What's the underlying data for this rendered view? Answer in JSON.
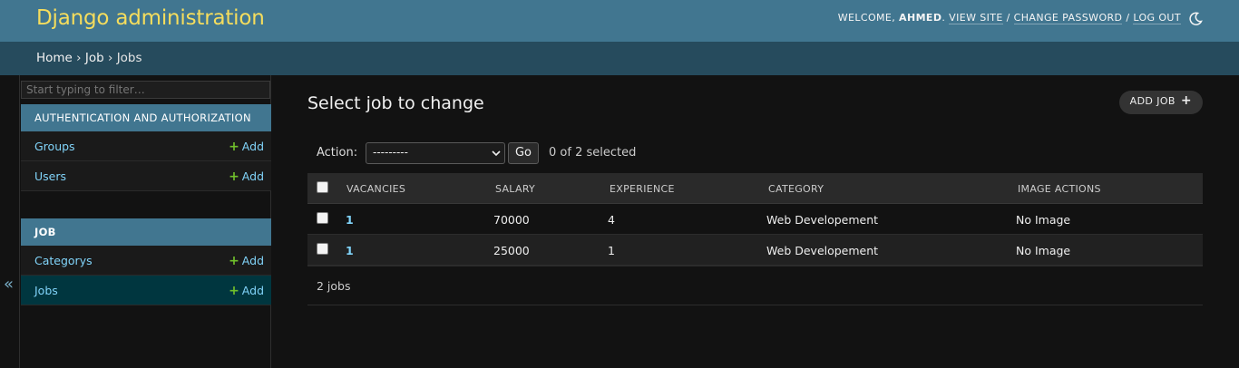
{
  "header": {
    "site_name": "Django administration",
    "welcome": "Welcome,",
    "username": "Ahmed",
    "view_site": "View site",
    "change_password": "Change password",
    "log_out": "Log out",
    "separator": "/"
  },
  "breadcrumbs": {
    "home": "Home",
    "app": "Job",
    "model": "Jobs",
    "sep": "›"
  },
  "sidebar": {
    "filter_placeholder": "Start typing to filter…",
    "toggle_glyph": "«",
    "modules": [
      {
        "caption": "Authentication and Authorization",
        "models": [
          {
            "name": "Groups",
            "add": "Add"
          },
          {
            "name": "Users",
            "add": "Add"
          }
        ]
      },
      {
        "caption": "Job",
        "models": [
          {
            "name": "Categorys",
            "add": "Add"
          },
          {
            "name": "Jobs",
            "add": "Add"
          }
        ]
      }
    ]
  },
  "main": {
    "title": "Select job to change",
    "add_button": "Add job",
    "action_label": "Action:",
    "action_selected": "---------",
    "go_label": "Go",
    "counter": "0 of 2 selected",
    "columns": [
      "Vacancies",
      "Salary",
      "Experience",
      "Category",
      "Image Actions"
    ],
    "rows": [
      {
        "vacancies": "1",
        "salary": "70000",
        "experience": "4",
        "category": "Web Developement",
        "image": "No Image"
      },
      {
        "vacancies": "1",
        "salary": "25000",
        "experience": "1",
        "category": "Web Developement",
        "image": "No Image"
      }
    ],
    "paginator": "2 jobs"
  },
  "colors": {
    "header_bg": "#417690",
    "breadcrumb_bg": "#264b5d",
    "brand_text": "#f5dd5d",
    "link": "#81d4fa",
    "add_plus": "#70bf2b",
    "page_bg": "#121212"
  },
  "icons": {
    "theme_toggle": "moon-icon",
    "add": "plus-icon",
    "collapse": "double-chevron-left-icon"
  }
}
